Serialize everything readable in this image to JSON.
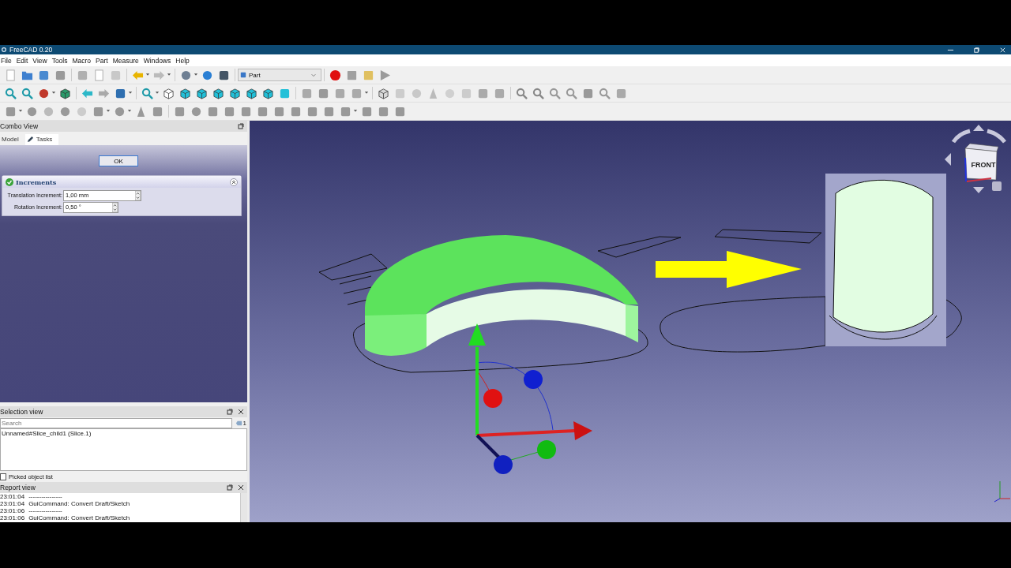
{
  "window": {
    "title": "FreeCAD 0.20"
  },
  "menu": [
    "File",
    "Edit",
    "View",
    "Tools",
    "Macro",
    "Part",
    "Measure",
    "Windows",
    "Help"
  ],
  "workbench": "Part",
  "combo_view": {
    "title": "Combo View",
    "tabs": [
      {
        "label": "Model",
        "selected": false
      },
      {
        "label": "Tasks",
        "selected": true
      }
    ],
    "ok_button": "OK",
    "panel": {
      "title": "Increments",
      "expanded": true,
      "fields": [
        {
          "label": "Translation Increment:",
          "value": "1,00 mm"
        },
        {
          "label": "Rotation Increment:",
          "value": "0,50 °"
        }
      ]
    }
  },
  "selection_view": {
    "title": "Selection view",
    "search": {
      "placeholder": "Search"
    },
    "count": "1",
    "items": [
      "Unnamed#Slice_child1 (Slice.1)"
    ],
    "picked_list": {
      "label": "Picked object list",
      "checked": false
    }
  },
  "report_view": {
    "title": "Report view",
    "lines": [
      {
        "time": "23:01:04",
        "text": "----------------"
      },
      {
        "time": "23:01:04",
        "text": "GuiCommand: Convert Draft/Sketch"
      },
      {
        "time": "23:01:06",
        "text": "----------------"
      },
      {
        "time": "23:01:06",
        "text": "GuiCommand: Convert Draft/Sketch"
      }
    ]
  },
  "navigation_cube": {
    "face": "FRONT"
  }
}
